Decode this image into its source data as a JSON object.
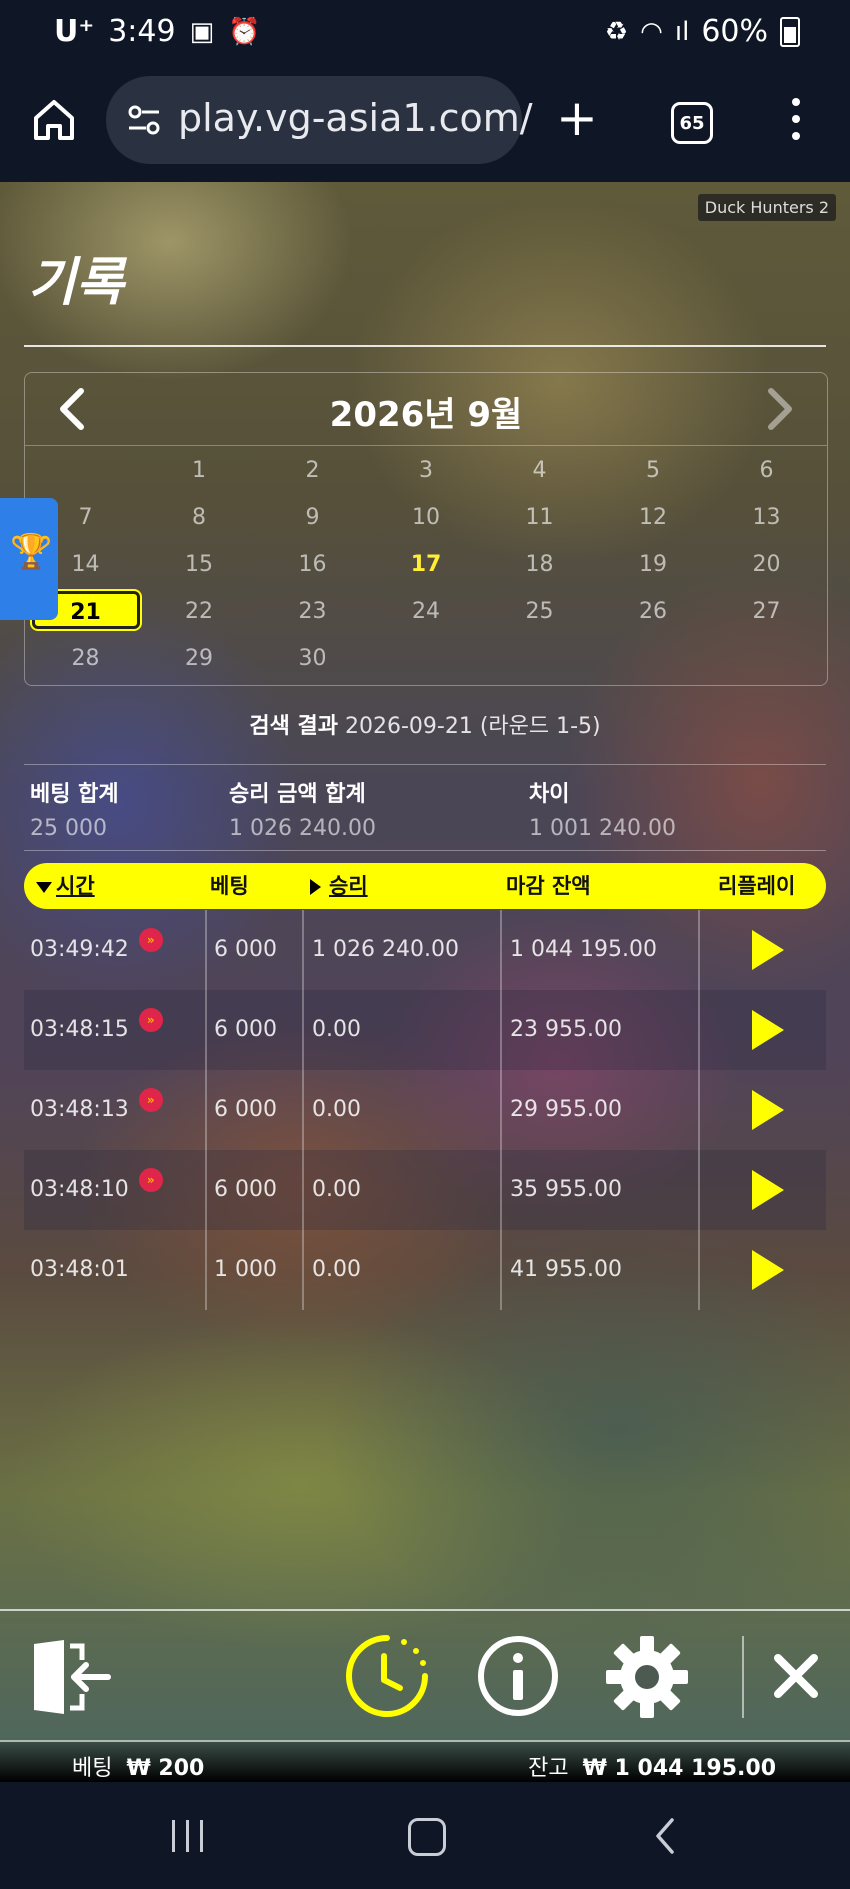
{
  "status_bar": {
    "carrier": "U⁺",
    "time": "3:49",
    "battery": "60%"
  },
  "browser": {
    "url": "play.vg-asia1.com/",
    "tab_count": "65"
  },
  "game_tag": "Duck Hunters 2",
  "page_title": "기록",
  "calendar": {
    "month_label": "2026년 9월",
    "today": "17",
    "selected": "21",
    "days": [
      "1",
      "2",
      "3",
      "4",
      "5",
      "6",
      "7",
      "8",
      "9",
      "10",
      "11",
      "12",
      "13",
      "14",
      "15",
      "16",
      "17",
      "18",
      "19",
      "20",
      "21",
      "22",
      "23",
      "24",
      "25",
      "26",
      "27",
      "28",
      "29",
      "30"
    ]
  },
  "search": {
    "label": "검색 결과",
    "value": "2026-09-21 (라운드 1-5)"
  },
  "summary": {
    "bet_total_label": "베팅 합계",
    "bet_total": "25 000",
    "win_total_label": "승리 금액 합계",
    "win_total": "1 026 240.00",
    "diff_label": "차이",
    "diff": "1 001 240.00"
  },
  "table": {
    "headers": {
      "time": "시간",
      "bet": "베팅",
      "win": "승리",
      "balance": "마감 잔액",
      "replay": "리플레이"
    },
    "rows": [
      {
        "time": "03:49:42",
        "badge": true,
        "bet": "6 000",
        "win": "1 026 240.00",
        "balance": "1 044 195.00"
      },
      {
        "time": "03:48:15",
        "badge": true,
        "bet": "6 000",
        "win": "0.00",
        "balance": "23 955.00"
      },
      {
        "time": "03:48:13",
        "badge": true,
        "bet": "6 000",
        "win": "0.00",
        "balance": "29 955.00"
      },
      {
        "time": "03:48:10",
        "badge": true,
        "bet": "6 000",
        "win": "0.00",
        "balance": "35 955.00"
      },
      {
        "time": "03:48:01",
        "badge": false,
        "bet": "1 000",
        "win": "0.00",
        "balance": "41 955.00"
      }
    ]
  },
  "footer": {
    "bet_label": "베팅",
    "bet_value": "₩ 200",
    "balance_label": "잔고",
    "balance_value": "₩ 1 044 195.00"
  },
  "colors": {
    "accent": "#ffff00",
    "badge": "#e0254a",
    "browser_bg": "#0f1626"
  }
}
